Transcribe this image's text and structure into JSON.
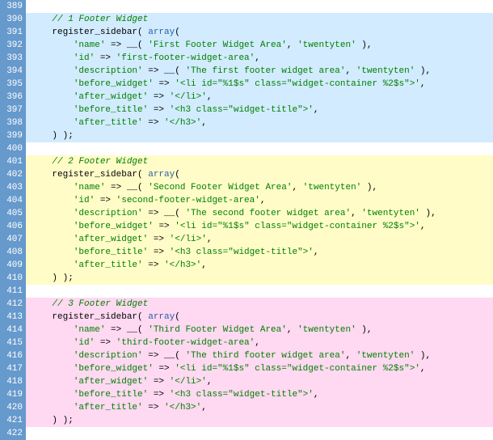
{
  "lines": [
    {
      "n": 389,
      "cls": "blank",
      "html": ""
    },
    {
      "n": 390,
      "cls": "b1",
      "html": "    <span class='com'>// 1 Footer Widget</span>"
    },
    {
      "n": 391,
      "cls": "b1",
      "html": "    <span class='fn'>register_sidebar</span>( <span class='arr'>array</span>("
    },
    {
      "n": 392,
      "cls": "b1",
      "html": "        <span class='str'>'name'</span> =&gt; __( <span class='str'>'First Footer Widget Area'</span>, <span class='str'>'twentyten'</span> ),"
    },
    {
      "n": 393,
      "cls": "b1",
      "html": "        <span class='str'>'id'</span> =&gt; <span class='str'>'first-footer-widget-area'</span>,"
    },
    {
      "n": 394,
      "cls": "b1",
      "html": "        <span class='str'>'description'</span> =&gt; __( <span class='str'>'The first footer widget area'</span>, <span class='str'>'twentyten'</span> ),"
    },
    {
      "n": 395,
      "cls": "b1",
      "html": "        <span class='str'>'before_widget'</span> =&gt; <span class='str'>'&lt;li id=\"%1$s\" class=\"widget-container %2$s\"&gt;'</span>,"
    },
    {
      "n": 396,
      "cls": "b1",
      "html": "        <span class='str'>'after_widget'</span> =&gt; <span class='str'>'&lt;/li&gt;'</span>,"
    },
    {
      "n": 397,
      "cls": "b1",
      "html": "        <span class='str'>'before_title'</span> =&gt; <span class='str'>'&lt;h3 class=\"widget-title\"&gt;'</span>,"
    },
    {
      "n": 398,
      "cls": "b1",
      "html": "        <span class='str'>'after_title'</span> =&gt; <span class='str'>'&lt;/h3&gt;'</span>,"
    },
    {
      "n": 399,
      "cls": "b1",
      "html": "    ) );"
    },
    {
      "n": 400,
      "cls": "blank",
      "html": ""
    },
    {
      "n": 401,
      "cls": "b2",
      "html": "    <span class='com'>// 2 Footer Widget</span>"
    },
    {
      "n": 402,
      "cls": "b2",
      "html": "    <span class='fn'>register_sidebar</span>( <span class='arr'>array</span>("
    },
    {
      "n": 403,
      "cls": "b2",
      "html": "        <span class='str'>'name'</span> =&gt; __( <span class='str'>'Second Footer Widget Area'</span>, <span class='str'>'twentyten'</span> ),"
    },
    {
      "n": 404,
      "cls": "b2",
      "html": "        <span class='str'>'id'</span> =&gt; <span class='str'>'second-footer-widget-area'</span>,"
    },
    {
      "n": 405,
      "cls": "b2",
      "html": "        <span class='str'>'description'</span> =&gt; __( <span class='str'>'The second footer widget area'</span>, <span class='str'>'twentyten'</span> ),"
    },
    {
      "n": 406,
      "cls": "b2",
      "html": "        <span class='str'>'before_widget'</span> =&gt; <span class='str'>'&lt;li id=\"%1$s\" class=\"widget-container %2$s\"&gt;'</span>,"
    },
    {
      "n": 407,
      "cls": "b2",
      "html": "        <span class='str'>'after_widget'</span> =&gt; <span class='str'>'&lt;/li&gt;'</span>,"
    },
    {
      "n": 408,
      "cls": "b2",
      "html": "        <span class='str'>'before_title'</span> =&gt; <span class='str'>'&lt;h3 class=\"widget-title\"&gt;'</span>,"
    },
    {
      "n": 409,
      "cls": "b2",
      "html": "        <span class='str'>'after_title'</span> =&gt; <span class='str'>'&lt;/h3&gt;'</span>,"
    },
    {
      "n": 410,
      "cls": "b2",
      "html": "    ) );"
    },
    {
      "n": 411,
      "cls": "blank",
      "html": ""
    },
    {
      "n": 412,
      "cls": "b3",
      "html": "    <span class='com'>// 3 Footer Widget</span>"
    },
    {
      "n": 413,
      "cls": "b3",
      "html": "    <span class='fn'>register_sidebar</span>( <span class='arr'>array</span>("
    },
    {
      "n": 414,
      "cls": "b3",
      "html": "        <span class='str'>'name'</span> =&gt; __( <span class='str'>'Third Footer Widget Area'</span>, <span class='str'>'twentyten'</span> ),"
    },
    {
      "n": 415,
      "cls": "b3",
      "html": "        <span class='str'>'id'</span> =&gt; <span class='str'>'third-footer-widget-area'</span>,"
    },
    {
      "n": 416,
      "cls": "b3",
      "html": "        <span class='str'>'description'</span> =&gt; __( <span class='str'>'The third footer widget area'</span>, <span class='str'>'twentyten'</span> ),"
    },
    {
      "n": 417,
      "cls": "b3",
      "html": "        <span class='str'>'before_widget'</span> =&gt; <span class='str'>'&lt;li id=\"%1$s\" class=\"widget-container %2$s\"&gt;'</span>,"
    },
    {
      "n": 418,
      "cls": "b3",
      "html": "        <span class='str'>'after_widget'</span> =&gt; <span class='str'>'&lt;/li&gt;'</span>,"
    },
    {
      "n": 419,
      "cls": "b3",
      "html": "        <span class='str'>'before_title'</span> =&gt; <span class='str'>'&lt;h3 class=\"widget-title\"&gt;'</span>,"
    },
    {
      "n": 420,
      "cls": "b3",
      "html": "        <span class='str'>'after_title'</span> =&gt; <span class='str'>'&lt;/h3&gt;'</span>,"
    },
    {
      "n": 421,
      "cls": "b3",
      "html": "    ) );"
    },
    {
      "n": 422,
      "cls": "blank",
      "html": ""
    }
  ]
}
